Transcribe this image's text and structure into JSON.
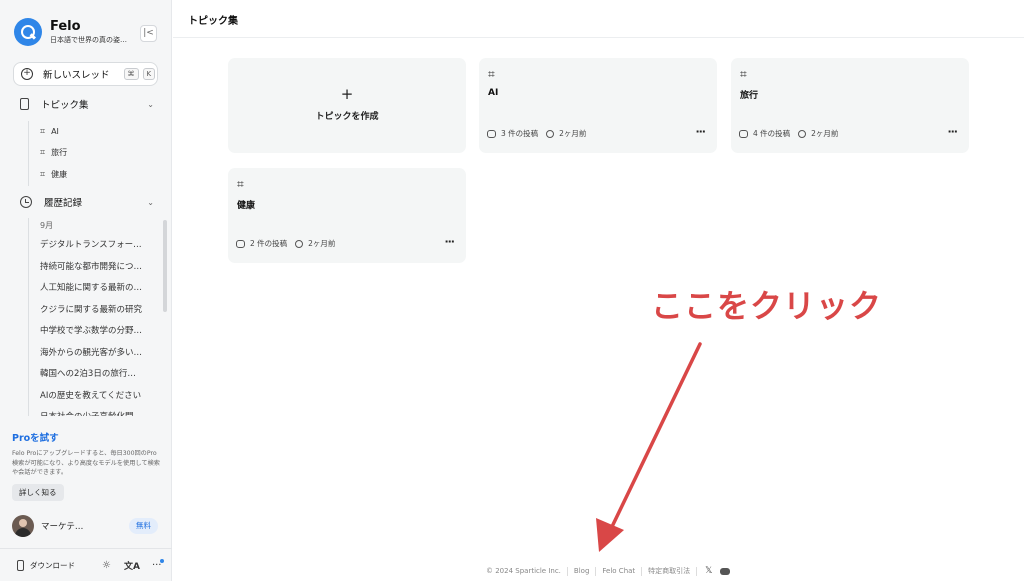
{
  "app": {
    "name": "Felo",
    "subtitle": "日本語で世界の真の姿…",
    "collapse_icon": "collapse-left-icon"
  },
  "sidebar": {
    "new_thread": {
      "label": "新しいスレッド",
      "kbd1": "⌘",
      "kbd2": "K"
    },
    "topics_header": "トピック集",
    "topics": [
      {
        "hash": "⌗",
        "label": "AI"
      },
      {
        "hash": "⌗",
        "label": "旅行"
      },
      {
        "hash": "⌗",
        "label": "健康"
      }
    ],
    "history_header": "履歴記録",
    "history_month": "9月",
    "history": [
      "デジタルトランスフォー…",
      "持続可能な都市開発につ…",
      "人工知能に関する最新の…",
      "クジラに関する最新の研究",
      "中学校で学ぶ数学の分野…",
      "海外からの観光客が多い…",
      "韓国への2泊3日の旅行…",
      "AIの歴史を教えてください",
      "日本社会の少子高齢化問…"
    ],
    "pro": {
      "title": "Proを試す",
      "desc": "Felo Proにアップグレードすると、毎日300回のPro検索が可能になり、より高度なモデルを使用して検索や会話ができます。",
      "button": "詳しく知る"
    },
    "user": {
      "name": "マーケテ…",
      "plan": "無料"
    },
    "bottom": {
      "download": "ダウンロード",
      "sun": "☼",
      "lang": "文A",
      "more": "···"
    }
  },
  "main": {
    "title": "トピック集",
    "create": {
      "plus": "+",
      "label": "トピックを作成"
    },
    "cards": [
      {
        "hash": "⌗",
        "name": "AI",
        "posts": "3 件の投稿",
        "time": "2ヶ月前",
        "dots": "···"
      },
      {
        "hash": "⌗",
        "name": "旅行",
        "posts": "4 件の投稿",
        "time": "2ヶ月前",
        "dots": "···"
      },
      {
        "hash": "⌗",
        "name": "健康",
        "posts": "2 件の投稿",
        "time": "2ヶ月前",
        "dots": "···"
      }
    ]
  },
  "annotation": {
    "text": "ここをクリック",
    "color": "#d94747"
  },
  "footer": {
    "copyright": "© 2024 Sparticle Inc.",
    "links": [
      "Blog",
      "Felo Chat",
      "特定商取引法"
    ],
    "x": "𝕏"
  },
  "colors": {
    "accent": "#2f86e8",
    "pro": "#1f6fe0",
    "annotation": "#d94747"
  }
}
